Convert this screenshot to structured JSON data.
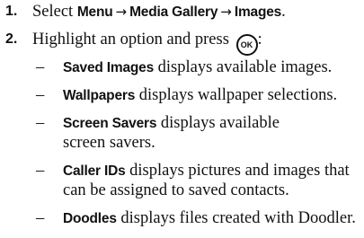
{
  "steps": [
    {
      "number": "1.",
      "prefix": "Select",
      "path": [
        "Menu",
        "Media Gallery",
        "Images"
      ],
      "arrow": "→",
      "suffix": "."
    },
    {
      "number": "2.",
      "text": "Highlight an option and press",
      "key_label": "OK",
      "suffix": ":"
    }
  ],
  "options": [
    {
      "dash": "–",
      "name": "Saved Images",
      "lines": [
        "displays available images."
      ]
    },
    {
      "dash": "–",
      "name": "Wallpapers",
      "lines": [
        "displays wallpaper selections."
      ]
    },
    {
      "dash": "–",
      "name": "Screen Savers",
      "lines": [
        "displays available",
        "screen savers."
      ]
    },
    {
      "dash": "–",
      "name": "Caller IDs",
      "lines": [
        "displays pictures and images that",
        "can be assigned to saved contacts."
      ]
    },
    {
      "dash": "–",
      "name": "Doodles",
      "lines": [
        "displays files created with Doodler."
      ]
    }
  ],
  "icons": {
    "ok_key": "ok-key-icon"
  }
}
